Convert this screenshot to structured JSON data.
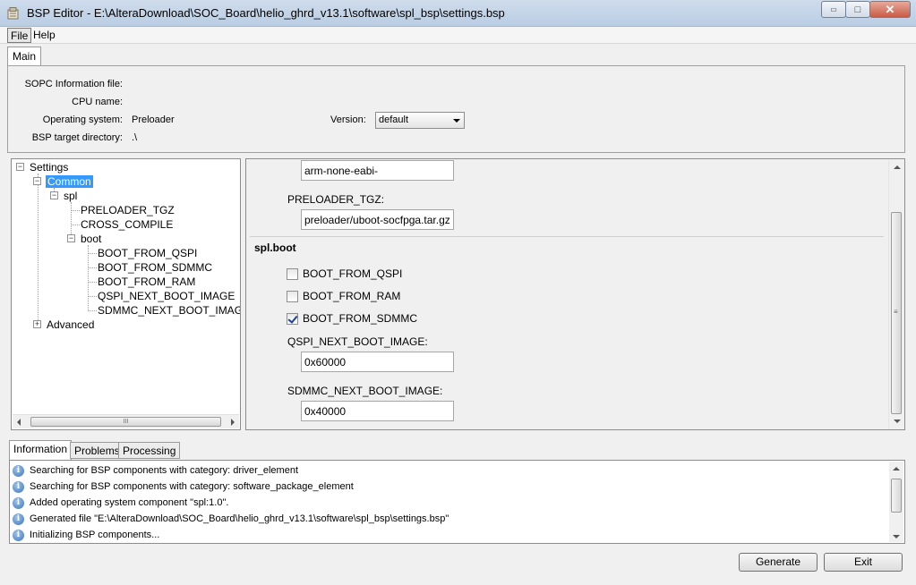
{
  "window": {
    "title": "BSP Editor - E:\\AlteraDownload\\SOC_Board\\helio_ghrd_v13.1\\software\\spl_bsp\\settings.bsp",
    "minimize": "▭",
    "maximize": "□",
    "close": "✕"
  },
  "menu": {
    "file": "File",
    "help": "Help"
  },
  "main_tab": "Main",
  "info": {
    "sopc_label": "SOPC Information file:",
    "sopc_value": "",
    "cpu_label": "CPU name:",
    "cpu_value": "",
    "os_label": "Operating system:",
    "os_value": "Preloader",
    "version_label": "Version:",
    "version_value": "default",
    "bsp_dir_label": "BSP target directory:",
    "bsp_dir_value": ".\\"
  },
  "tree": {
    "settings": "Settings",
    "common": "Common",
    "spl": "spl",
    "preloader_tgz": "PRELOADER_TGZ",
    "cross_compile": "CROSS_COMPILE",
    "boot": "boot",
    "boot_from_qspi": "BOOT_FROM_QSPI",
    "boot_from_sdmmc": "BOOT_FROM_SDMMC",
    "boot_from_ram": "BOOT_FROM_RAM",
    "qspi_next": "QSPI_NEXT_BOOT_IMAGE",
    "sdmmc_next": "SDMMC_NEXT_BOOT_IMAGE",
    "advanced": "Advanced",
    "hscroll_grip": "III"
  },
  "props": {
    "cross_compile_value": "arm-none-eabi-",
    "preloader_tgz_label": "PRELOADER_TGZ:",
    "preloader_tgz_value": "preloader/uboot-socfpga.tar.gz",
    "group_title": "spl.boot",
    "cb_qspi": {
      "label": "BOOT_FROM_QSPI",
      "checked": false
    },
    "cb_ram": {
      "label": "BOOT_FROM_RAM",
      "checked": false
    },
    "cb_sdmmc": {
      "label": "BOOT_FROM_SDMMC",
      "checked": true
    },
    "qspi_next_label": "QSPI_NEXT_BOOT_IMAGE:",
    "qspi_next_value": "0x60000",
    "sdmmc_next_label": "SDMMC_NEXT_BOOT_IMAGE:",
    "sdmmc_next_value": "0x40000",
    "vscroll_grip": "≡"
  },
  "bottom_tabs": {
    "information": "Information",
    "problems": "Problems",
    "processing": "Processing"
  },
  "messages": [
    "Searching for BSP components with category: driver_element",
    "Searching for BSP components with category: software_package_element",
    "Added operating system component \"spl:1.0\".",
    "Generated file \"E:\\AlteraDownload\\SOC_Board\\helio_ghrd_v13.1\\software\\spl_bsp\\settings.bsp\"",
    "Initializing BSP components..."
  ],
  "info_icon_glyph": "i",
  "buttons": {
    "generate": "Generate",
    "exit": "Exit"
  },
  "colors": {
    "selection": "#3399ff",
    "titlebar": "#b9cde3",
    "close_button": "#c85c46"
  }
}
